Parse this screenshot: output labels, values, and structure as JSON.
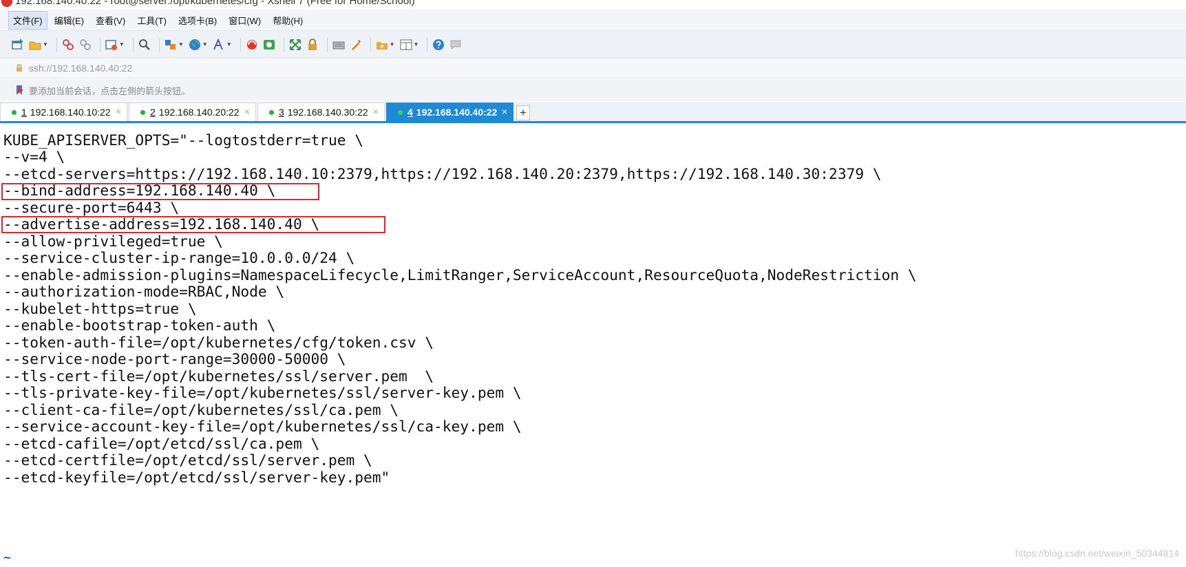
{
  "window": {
    "title": "192.168.140.40:22 - root@server:/opt/kubernetes/cfg - Xshell 7 (Free for Home/School)"
  },
  "menu": [
    "文件(F)",
    "编辑(E)",
    "查看(V)",
    "工具(T)",
    "选项卡(B)",
    "窗口(W)",
    "帮助(H)"
  ],
  "address": {
    "value": "ssh://192.168.140.40:22"
  },
  "hint": {
    "text": "要添加当前会话，点击左侧的箭头按钮。"
  },
  "tabs": [
    {
      "num": "1",
      "label": "192.168.140.10:22",
      "active": false
    },
    {
      "num": "2",
      "label": "192.168.140.20:22",
      "active": false
    },
    {
      "num": "3",
      "label": "192.168.140.30:22",
      "active": false
    },
    {
      "num": "4",
      "label": "192.168.140.40:22",
      "active": true
    }
  ],
  "tab_add_label": "+",
  "tab_close_label": "×",
  "terminal": {
    "lines": [
      "KUBE_APISERVER_OPTS=\"--logtostderr=true \\",
      "--v=4 \\",
      "--etcd-servers=https://192.168.140.10:2379,https://192.168.140.20:2379,https://192.168.140.30:2379 \\",
      "--bind-address=192.168.140.40 \\",
      "--secure-port=6443 \\",
      "--advertise-address=192.168.140.40 \\",
      "--allow-privileged=true \\",
      "--service-cluster-ip-range=10.0.0.0/24 \\",
      "--enable-admission-plugins=NamespaceLifecycle,LimitRanger,ServiceAccount,ResourceQuota,NodeRestriction \\",
      "--authorization-mode=RBAC,Node \\",
      "--kubelet-https=true \\",
      "--enable-bootstrap-token-auth \\",
      "--token-auth-file=/opt/kubernetes/cfg/token.csv \\",
      "--service-node-port-range=30000-50000 \\",
      "--tls-cert-file=/opt/kubernetes/ssl/server.pem  \\",
      "--tls-private-key-file=/opt/kubernetes/ssl/server-key.pem \\",
      "--client-ca-file=/opt/kubernetes/ssl/ca.pem \\",
      "--service-account-key-file=/opt/kubernetes/ssl/ca-key.pem \\",
      "--etcd-cafile=/opt/etcd/ssl/ca.pem \\",
      "--etcd-certfile=/opt/etcd/ssl/server.pem \\",
      "--etcd-keyfile=/opt/etcd/ssl/server-key.pem\""
    ],
    "tilde": "~"
  },
  "watermark": "https://blog.csdn.net/weixin_50344814",
  "colors": {
    "accent": "#1e8ad6",
    "highlight": "#e0262b",
    "status_dot": "#1bb53a"
  }
}
